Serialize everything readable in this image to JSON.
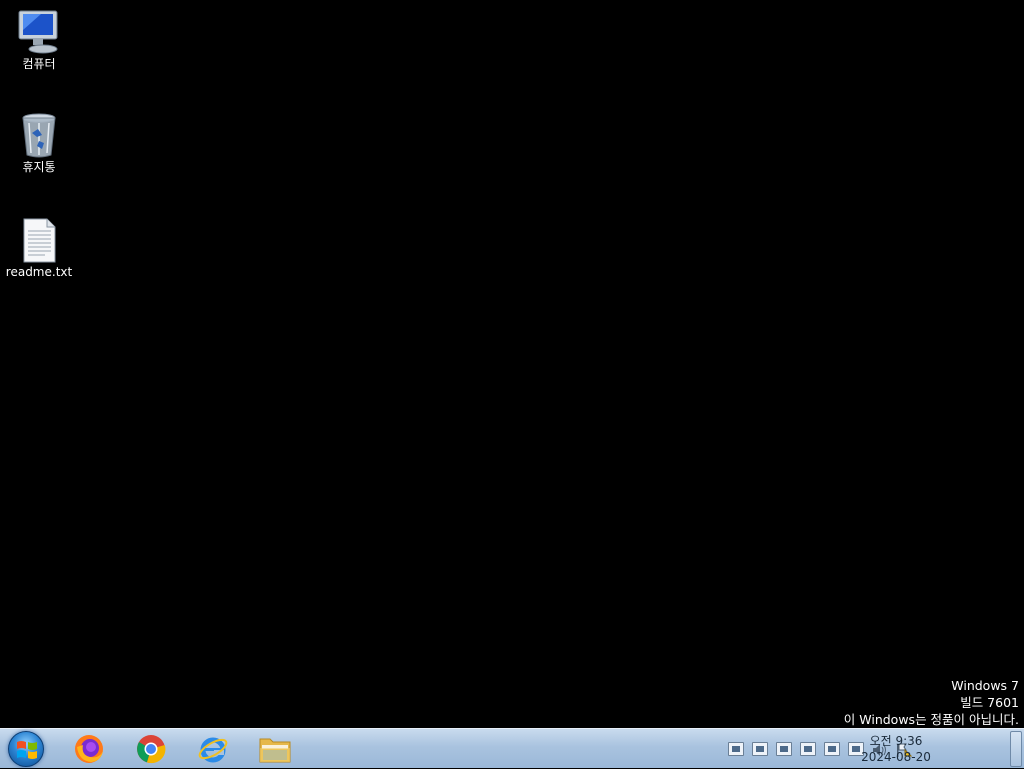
{
  "desktop": {
    "icons": [
      {
        "label": "컴퓨터",
        "icon": "computer-icon"
      },
      {
        "label": "휴지통",
        "icon": "recycle-bin-icon"
      },
      {
        "label": "readme.txt",
        "icon": "text-file-icon"
      }
    ]
  },
  "watermark": {
    "line1": "Windows 7",
    "line2": "빌드 7601",
    "line3": "이 Windows는 정품이 아닙니다."
  },
  "taskbar": {
    "start_icon": "windows-start-icon",
    "apps": [
      {
        "name": "firefox",
        "icon": "firefox-icon"
      },
      {
        "name": "chrome",
        "icon": "chrome-icon"
      },
      {
        "name": "internet-explorer",
        "icon": "internet-explorer-icon"
      },
      {
        "name": "file-explorer",
        "icon": "folder-icon"
      }
    ]
  },
  "tray": {
    "time": "오전 9:36",
    "date": "2024-08-20"
  },
  "colors": {
    "desktop_background": "#000000",
    "taskbar": "#a9c3df",
    "text": "#ffffff"
  }
}
